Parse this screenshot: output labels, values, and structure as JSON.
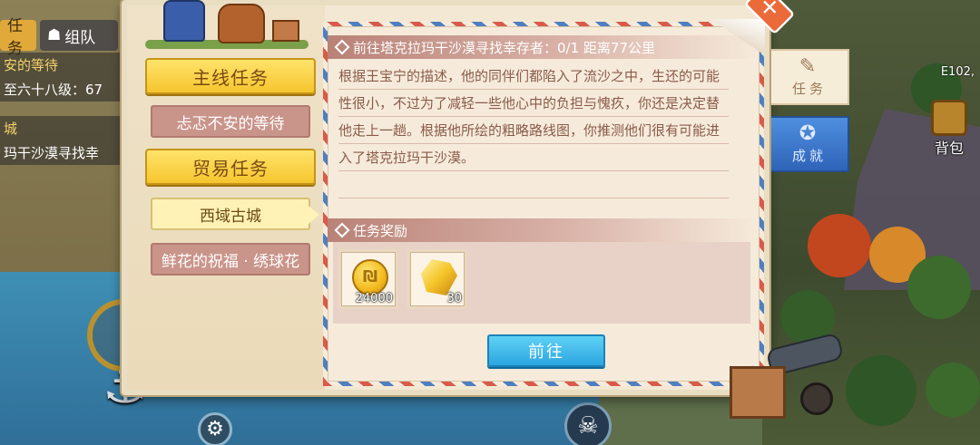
{
  "tracker": {
    "tab_task": "任务",
    "tab_team": "组队",
    "rows": [
      "安的等待",
      "至六十八级：67",
      "城",
      "玛干沙漠寻找幸"
    ]
  },
  "map": {
    "coord_label": "E102,"
  },
  "panel": {
    "categories": [
      {
        "label": "主线任务"
      },
      {
        "label": "贸易任务"
      }
    ],
    "quests": [
      {
        "label": "忐忑不安的等待"
      },
      {
        "label": "西域古城"
      },
      {
        "label": "鲜花的祝福 · 绣球花"
      }
    ],
    "quest_title": "前往塔克拉玛干沙漠寻找幸存者：0/1 距离77公里",
    "description": "根据王宝宁的描述，他的同伴们都陷入了流沙之中，生还的可能性很小，不过为了减轻一些他心中的负担与愧疚，你还是决定替他走上一趟。根据他所绘的粗略路线图，你推测他们很有可能进入了塔克拉玛干沙漠。",
    "reward_header": "任务奖励",
    "rewards": [
      {
        "icon": "gold-coin-icon",
        "count": "24000"
      },
      {
        "icon": "gold-gem-icon",
        "count": "30"
      }
    ],
    "goto_label": "前往"
  },
  "side_tabs": {
    "task": "任务",
    "achievement": "成就"
  },
  "backpack_label": "背包",
  "colors": {
    "accent_yellow": "#f6c52e",
    "accent_blue": "#2ca6e0",
    "close_orange": "#ea6a3a"
  }
}
